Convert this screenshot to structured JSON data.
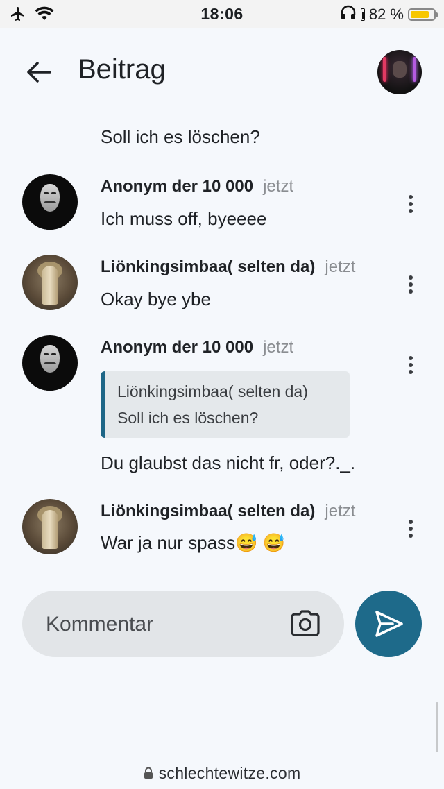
{
  "status_bar": {
    "time": "18:06",
    "battery_percent_label": "82 %",
    "battery_level": 0.82,
    "icons": [
      "airplane-icon",
      "wifi-icon",
      "headphones-icon",
      "battery-icon"
    ]
  },
  "header": {
    "title": "Beitrag",
    "back_icon": "arrow-left-icon"
  },
  "thread": {
    "preceding_text": "Soll ich es löschen?",
    "comments": [
      {
        "author": "Anonym der 10 000",
        "time": "jetzt",
        "text": "Ich muss off, byeeee"
      },
      {
        "author": "Liönkingsimbaa( selten da)",
        "time": "jetzt",
        "text": "Okay bye ybe"
      },
      {
        "author": "Anonym der 10 000",
        "time": "jetzt",
        "quote": {
          "author": "Liönkingsimbaa( selten da)",
          "text": "Soll ich es löschen?"
        },
        "text": "Du glaubst das nicht fr, oder?._."
      },
      {
        "author": "Liönkingsimbaa( selten da)",
        "time": "jetzt",
        "text": "War ja nur spass😅 😅"
      }
    ]
  },
  "composer": {
    "placeholder": "Kommentar",
    "camera_icon": "camera-icon",
    "send_icon": "send-icon",
    "accent_color": "#1e6a8a"
  },
  "browser": {
    "url": "schlechtewitze.com"
  }
}
